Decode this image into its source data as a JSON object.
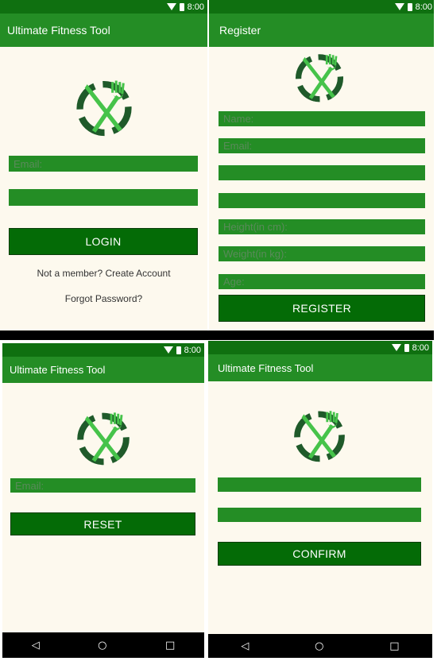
{
  "status": {
    "time": "8:00"
  },
  "login": {
    "title": "Ultimate Fitness Tool",
    "email_placeholder": "Email:",
    "password_placeholder": "",
    "login_label": "LOGIN",
    "create_account_text": "Not a member? Create Account",
    "forgot_password_text": "Forgot Password?"
  },
  "register": {
    "title": "Register",
    "fields": [
      "Name:",
      "Email:",
      "",
      "",
      "Height(in cm):",
      "Weight(in kg):",
      "Age:"
    ],
    "register_label": "REGISTER"
  },
  "reset": {
    "title": "Ultimate Fitness Tool",
    "email_placeholder": "Email:",
    "reset_label": "RESET"
  },
  "confirm": {
    "title": "Ultimate Fitness Tool",
    "field1": "",
    "field2": "",
    "confirm_label": "CONFIRM"
  },
  "icons": [
    "wifi-icon",
    "battery-icon",
    "back-icon",
    "home-icon",
    "recents-icon",
    "fork-knife-logo"
  ],
  "colors": {
    "appbar": "#248d25",
    "statusbar": "#0f7010",
    "button": "#046b06",
    "background": "#fdf9ee"
  }
}
